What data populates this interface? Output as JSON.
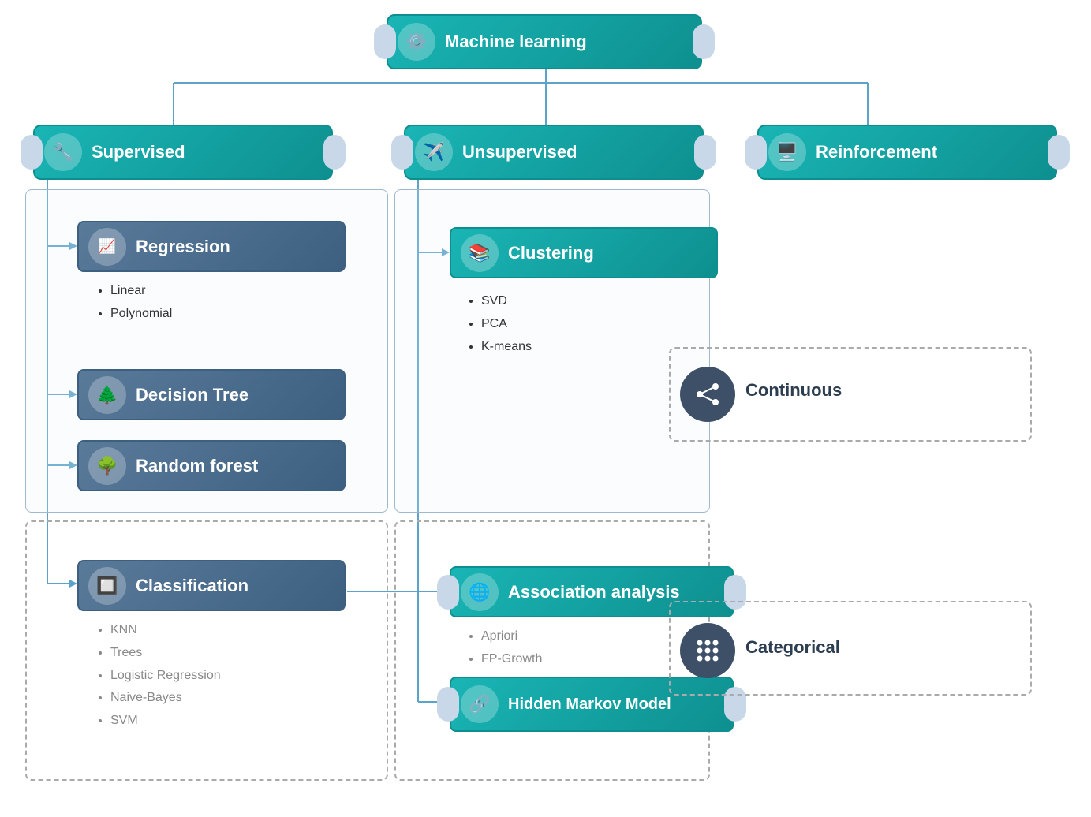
{
  "title": "Machine learning",
  "root": {
    "label": "Machine learning",
    "icon": "⚙️"
  },
  "level1": [
    {
      "label": "Supervised",
      "icon": "🔧"
    },
    {
      "label": "Unsupervised",
      "icon": "✈️"
    },
    {
      "label": "Reinforcement",
      "icon": "🖥️"
    }
  ],
  "supervised_children": [
    {
      "label": "Regression",
      "icon": "📈",
      "bullets": [
        "Linear",
        "Polynomial"
      ]
    },
    {
      "label": "Decision Tree",
      "icon": "🌲",
      "bullets": []
    },
    {
      "label": "Random forest",
      "icon": "🌳",
      "bullets": []
    },
    {
      "label": "Classification",
      "icon": "🔲",
      "bullets": [
        "KNN",
        "Trees",
        "Logistic Regression",
        "Naive-Bayes",
        "SVM"
      ]
    }
  ],
  "unsupervised_children": [
    {
      "label": "Clustering",
      "icon": "📚",
      "bullets": [
        "SVD",
        "PCA",
        "K-means"
      ]
    },
    {
      "label": "Association analysis",
      "icon": "🌐",
      "bullets": [
        "Apriori",
        "FP-Growth"
      ]
    },
    {
      "label": "Hidden Markov Model",
      "icon": "🔗",
      "bullets": []
    }
  ],
  "continuous_label": "Continuous",
  "categorical_label": "Categorical"
}
